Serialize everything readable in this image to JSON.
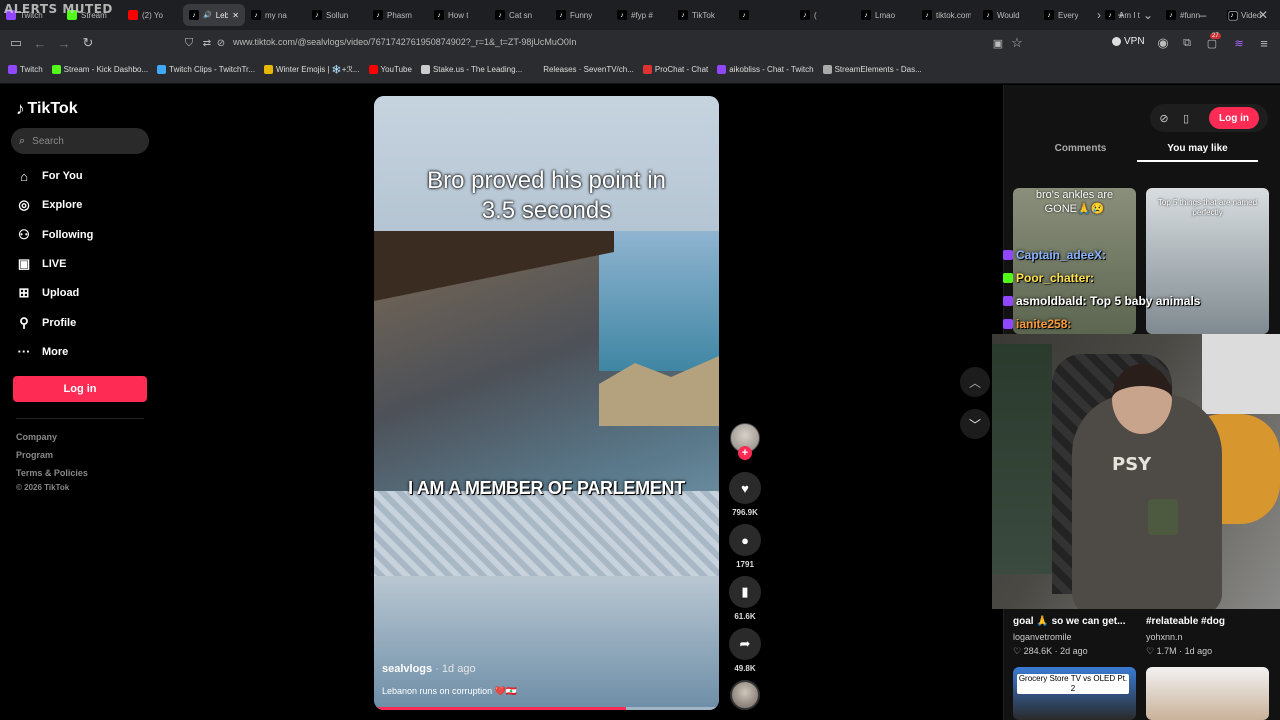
{
  "overlay_title": "ALERTS MUTED",
  "browser": {
    "tabs": [
      {
        "label": "Twitch",
        "icon": "twitch-icon",
        "color": "#9146ff"
      },
      {
        "label": "Stream",
        "icon": "kick-icon",
        "color": "#53fc18"
      },
      {
        "label": "(2) Yo",
        "icon": "youtube-icon",
        "color": "#ff0000"
      },
      {
        "label": "Leb",
        "icon": "tiktok-icon",
        "color": "#000000"
      },
      {
        "label": "my na",
        "icon": "tiktok-icon",
        "color": "#000000"
      },
      {
        "label": "Sollun",
        "icon": "tiktok-icon",
        "color": "#000000"
      },
      {
        "label": "Phasm",
        "icon": "tiktok-icon",
        "color": "#000000"
      },
      {
        "label": "How t",
        "icon": "tiktok-icon",
        "color": "#000000"
      },
      {
        "label": "Cat sn",
        "icon": "tiktok-icon",
        "color": "#000000"
      },
      {
        "label": "Funny",
        "icon": "tiktok-icon",
        "color": "#000000"
      },
      {
        "label": "#fyp #",
        "icon": "tiktok-icon",
        "color": "#000000"
      },
      {
        "label": "TikTok",
        "icon": "tiktok-icon",
        "color": "#000000"
      },
      {
        "label": "",
        "icon": "tiktok-icon",
        "color": "#000000"
      },
      {
        "label": "(",
        "icon": "tiktok-icon",
        "color": "#000000"
      },
      {
        "label": "Lmao",
        "icon": "tiktok-icon",
        "color": "#000000"
      },
      {
        "label": "tiktok.com",
        "icon": "tiktok-icon",
        "color": "#000000"
      },
      {
        "label": "Would",
        "icon": "tiktok-icon",
        "color": "#000000"
      },
      {
        "label": "Every",
        "icon": "tiktok-icon",
        "color": "#000000"
      },
      {
        "label": "Am I t",
        "icon": "tiktok-icon",
        "color": "#000000"
      },
      {
        "label": "#funn",
        "icon": "tiktok-icon",
        "color": "#000000"
      },
      {
        "label": "Video",
        "icon": "tiktok-icon",
        "color": "#000000"
      }
    ],
    "url": "www.tiktok.com/@sealvlogs/video/7671742761950874902?_r=1&_t=ZT-98jUcMuO0In",
    "vpn_label": "VPN",
    "extension_badge": "27",
    "bookmarks": [
      {
        "label": "Twitch",
        "color": "#9146ff"
      },
      {
        "label": "Stream - Kick Dashbo...",
        "color": "#53fc18"
      },
      {
        "label": "Twitch Clips - TwitchTr...",
        "color": "#3fa9f5"
      },
      {
        "label": "Winter Emojis | ❄️+ℛ...",
        "color": "#e6b800"
      },
      {
        "label": "YouTube",
        "color": "#ff0000"
      },
      {
        "label": "Stake.us - The Leading...",
        "color": "#cccccc"
      },
      {
        "label": "Releases · SevenTV/ch...",
        "color": "#2b2c2f"
      },
      {
        "label": "ProChat - Chat",
        "color": "#d33"
      },
      {
        "label": "aikobliss - Chat - Twitch",
        "color": "#9146ff"
      },
      {
        "label": "StreamElements - Das...",
        "color": "#aaaaaa"
      }
    ]
  },
  "tiktok": {
    "brand": "TikTok",
    "search_placeholder": "Search",
    "nav": [
      {
        "label": "For You",
        "icon": "home-icon"
      },
      {
        "label": "Explore",
        "icon": "compass-icon"
      },
      {
        "label": "Following",
        "icon": "user-follow-icon"
      },
      {
        "label": "LIVE",
        "icon": "live-icon"
      },
      {
        "label": "Upload",
        "icon": "plus-square-icon"
      },
      {
        "label": "Profile",
        "icon": "person-icon"
      },
      {
        "label": "More",
        "icon": "more-icon"
      }
    ],
    "login_label": "Log in",
    "footer": [
      "Company",
      "Program",
      "Terms & Policies",
      "© 2026 TikTok"
    ],
    "accent": "#fe2c55"
  },
  "video": {
    "caption_top": "Bro proved his point in 3.5 seconds",
    "caption_mid": "I AM A MEMBER OF PARLEMENT",
    "author": "sealvlogs",
    "ago": " · 1d ago",
    "description": "Lebanon runs on corruption 💔🇱🇧",
    "progress": 0.73,
    "likes": "796.9K",
    "comments": "1791",
    "saves": "61.6K",
    "shares": "49.8K"
  },
  "right_panel": {
    "login_label": "Log in",
    "tabs": [
      "Comments",
      "You may like"
    ],
    "thumb_captions": [
      "bro's ankles are GONE🙏😢",
      "Top 5 things that are named perfectly"
    ],
    "cards": [
      {
        "title": "goal 🙏 so we can get...",
        "user": "loganvetromile",
        "likes": "284.6K",
        "ago": "2d ago"
      },
      {
        "title": "#relateable #dog",
        "user": "yohxnn.n",
        "likes": "1.7M",
        "ago": "1d ago"
      }
    ],
    "bottom_thumb_caption": "Grocery Store TV vs OLED Pt. 2"
  },
  "stream_chat": [
    {
      "text": "Captain_adeeX:",
      "color": "#8ab4ff"
    },
    {
      "text": "Poor_chatter:",
      "color": "#ffe14d"
    },
    {
      "text": "asmoldbald: Top 5 baby animals",
      "color": "#ffffff"
    },
    {
      "text": "ianite258:",
      "color": "#ff9a3c"
    }
  ],
  "webcam_shirt_text": "PSY"
}
